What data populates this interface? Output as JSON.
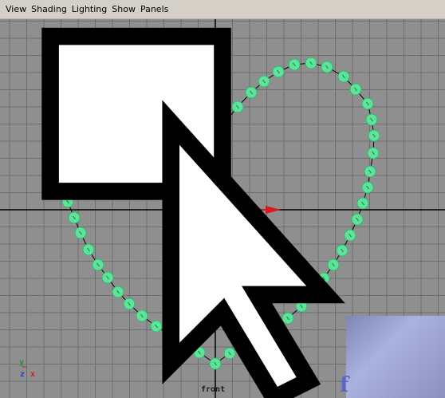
{
  "menu": {
    "items": [
      "View",
      "Shading",
      "Lighting",
      "Show",
      "Panels"
    ]
  },
  "viewport": {
    "camera_label": "front",
    "axis_labels": {
      "y": "y",
      "z": "z",
      "x": "x"
    },
    "colors": {
      "background": "#8f8f8f",
      "grid_line": "#6e6e6e",
      "axis_line": "#000000",
      "curve": "#000000",
      "cv_fill": "#5fe39a",
      "cv_stroke": "#35b86e",
      "manip_y": "#1e8a3c",
      "manip_x": "#d81818",
      "pivot": "#f2d300"
    },
    "tool": "move-manipulator",
    "cursor": "arrow-with-box"
  },
  "overlay": {
    "glyph": "f"
  }
}
